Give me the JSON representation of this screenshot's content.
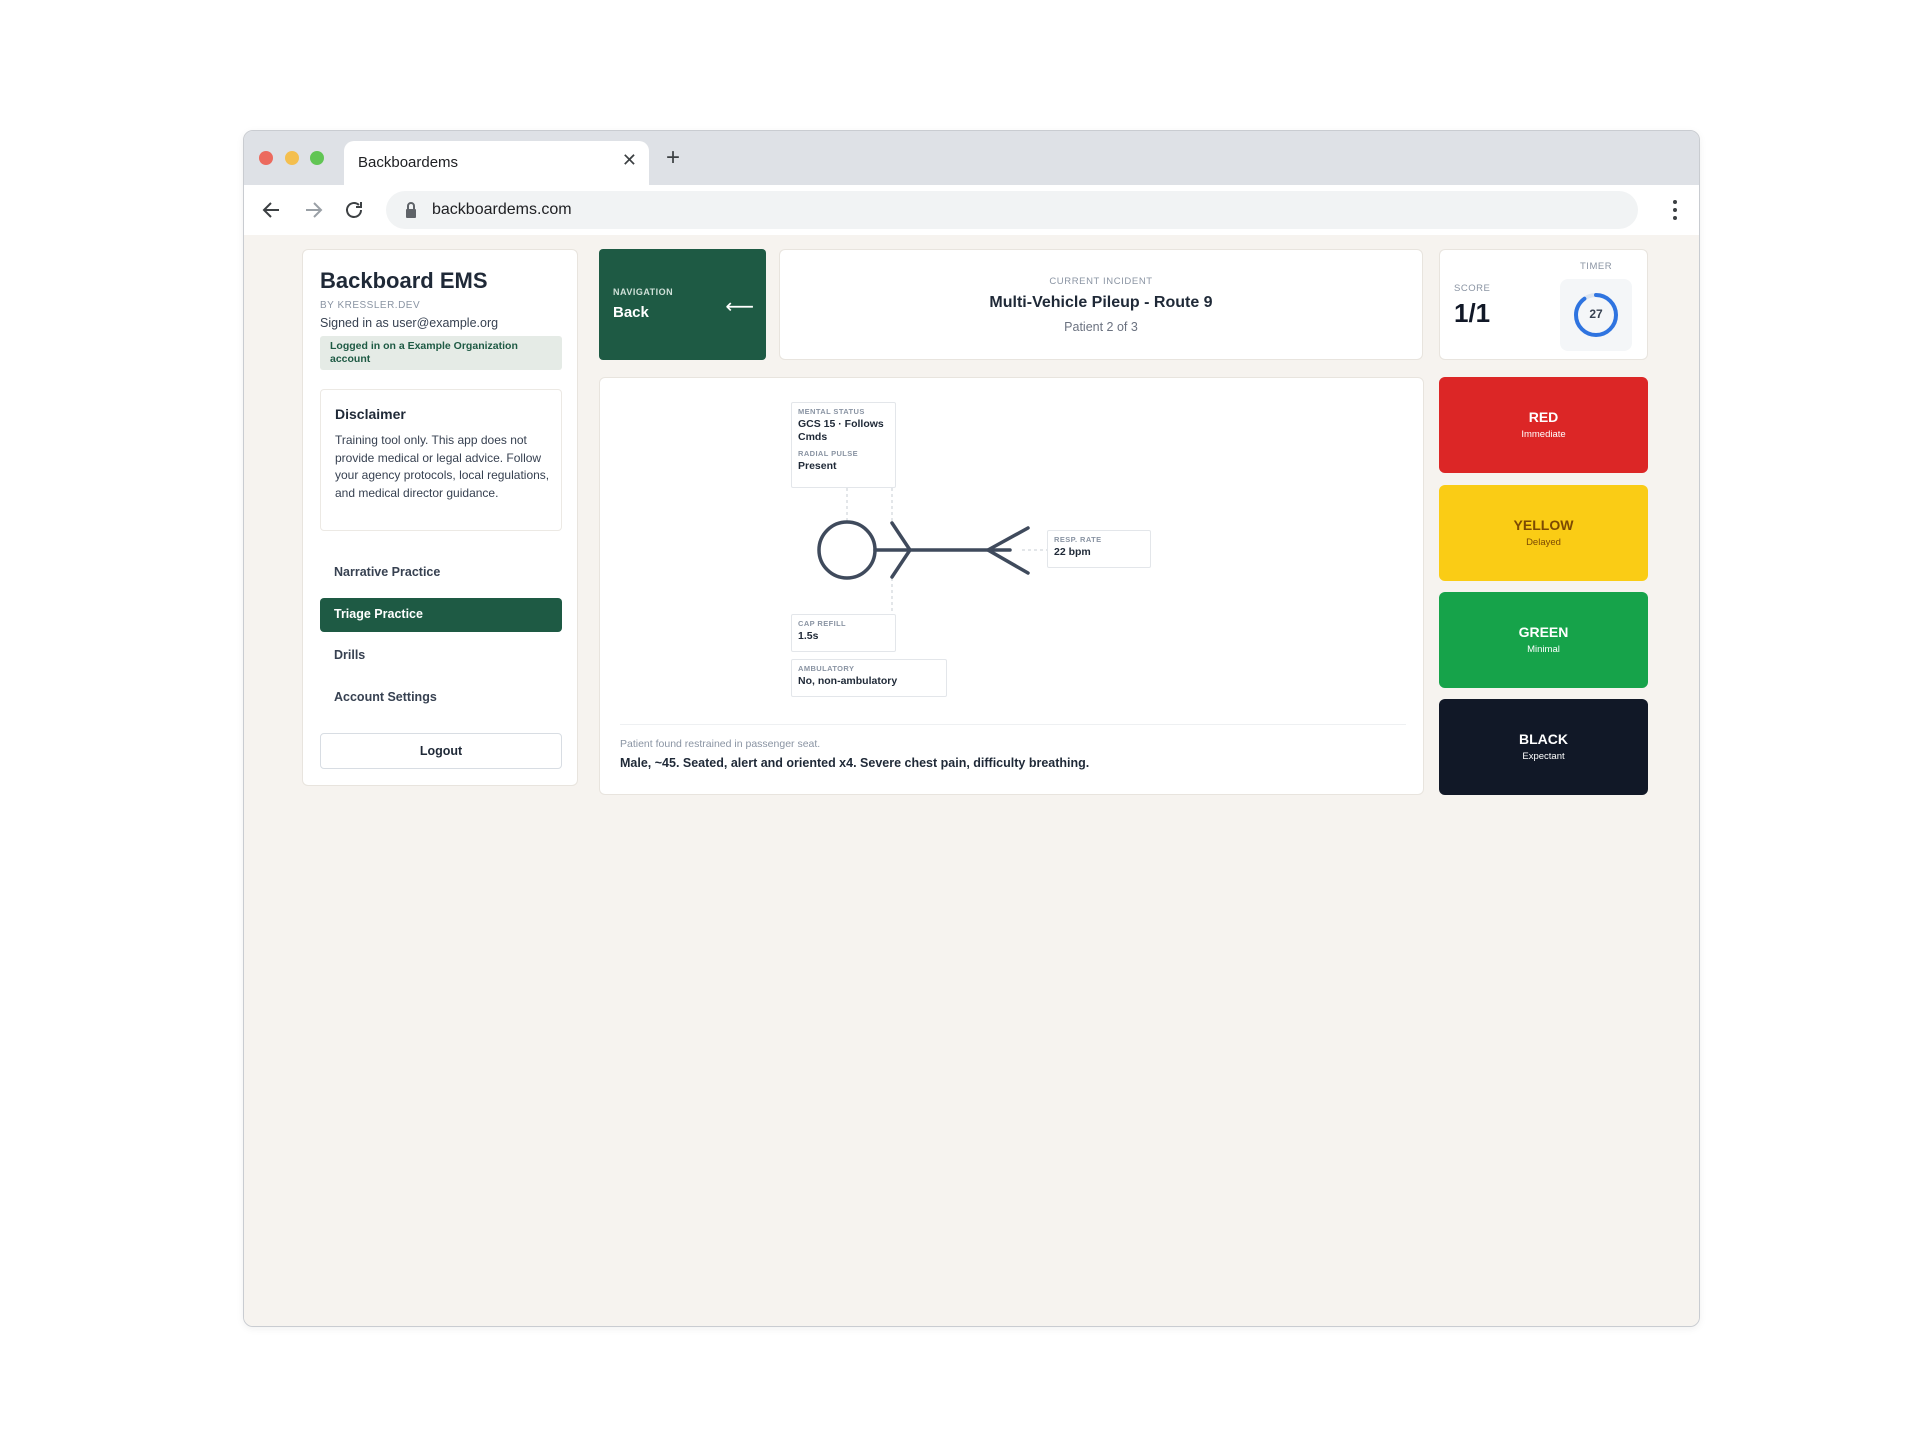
{
  "browser": {
    "tab_title": "Backboardems",
    "url": "backboardems.com"
  },
  "sidebar": {
    "title": "Backboard EMS",
    "byline": "BY KRESSLER.DEV",
    "signed_in": "Signed in as user@example.org",
    "org_banner": "Logged in on a Example Organization account",
    "disclaimer": {
      "title": "Disclaimer",
      "body": "Training tool only. This app does not provide medical or legal advice. Follow your agency protocols, local regulations, and medical director guidance."
    },
    "nav": [
      {
        "label": "Narrative Practice",
        "active": false
      },
      {
        "label": "Triage Practice",
        "active": true
      },
      {
        "label": "Drills",
        "active": false
      },
      {
        "label": "Account Settings",
        "active": false
      }
    ],
    "logout": "Logout"
  },
  "navigation": {
    "label": "NAVIGATION",
    "back": "Back",
    "arrow": "⟵"
  },
  "incident": {
    "label": "CURRENT INCIDENT",
    "title": "Multi-Vehicle Pileup - Route 9",
    "patient": "Patient 2 of 3"
  },
  "score": {
    "label": "SCORE",
    "value": "1/1",
    "timer_label": "TIMER",
    "timer_value": "27",
    "timer_fraction": 0.9
  },
  "patient": {
    "vitals": {
      "mental_status": {
        "label": "MENTAL STATUS",
        "value": "GCS 15 · Follows Cmds"
      },
      "radial_pulse": {
        "label": "RADIAL PULSE",
        "value": "Present"
      },
      "resp_rate": {
        "label": "RESP. RATE",
        "value": "22 bpm"
      },
      "cap_refill": {
        "label": "CAP REFILL",
        "value": "1.5s"
      },
      "ambulatory": {
        "label": "AMBULATORY",
        "value": "No, non-ambulatory"
      }
    },
    "found": "Patient found restrained in passenger seat.",
    "description": "Male, ~45. Seated, alert and oriented x4. Severe chest pain, difficulty breathing."
  },
  "triage": [
    {
      "name": "RED",
      "sub": "Immediate",
      "color": "#dc2626",
      "text": "#ffffff"
    },
    {
      "name": "YELLOW",
      "sub": "Delayed",
      "color": "#facc15",
      "text": "#7c4a03"
    },
    {
      "name": "GREEN",
      "sub": "Minimal",
      "color": "#16a34a",
      "text": "#ffffff"
    },
    {
      "name": "BLACK",
      "sub": "Expectant",
      "color": "#111827",
      "text": "#ffffff"
    }
  ],
  "icons": [
    "back-arrow-icon",
    "forward-arrow-icon",
    "reload-icon",
    "lock-icon",
    "kebab-menu-icon",
    "close-icon",
    "plus-icon",
    "left-arrow-icon",
    "timer-ring-icon",
    "stick-figure-icon"
  ]
}
